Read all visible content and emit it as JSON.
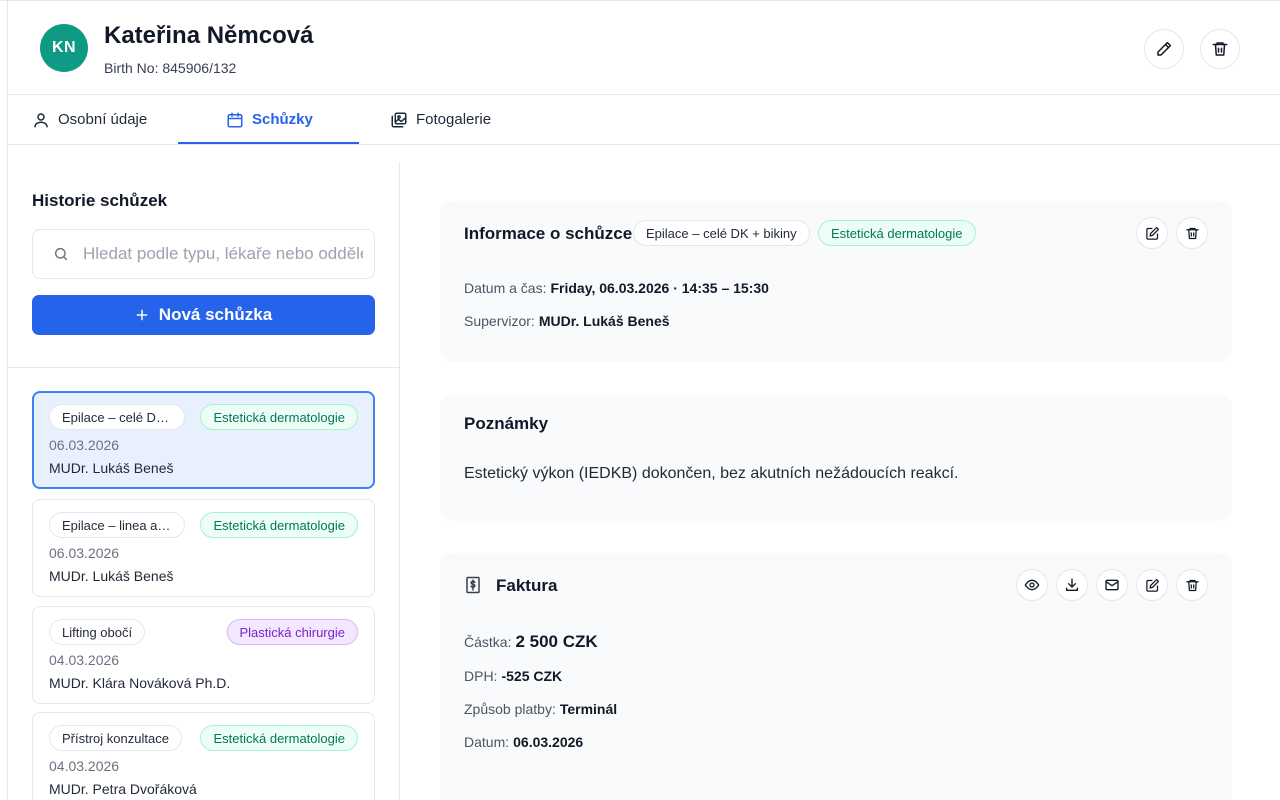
{
  "patient": {
    "initials": "KN",
    "name": "Kateřina Němcová",
    "birth_no": "Birth No: 845906/132"
  },
  "tabs": [
    {
      "label": "Osobní údaje",
      "icon": "user-icon",
      "active": false
    },
    {
      "label": "Schůzky",
      "icon": "calendar-icon",
      "active": true
    },
    {
      "label": "Fotogalerie",
      "icon": "gallery-icon",
      "active": false
    }
  ],
  "history": {
    "title": "Historie schůzek",
    "search_placeholder": "Hledat podle typu, lékaře nebo oddělení",
    "new_button": "Nová schůzka",
    "items": [
      {
        "type": "Epilace – celé DK + bikiny",
        "dept": "Estetická dermatologie",
        "dept_color": "green",
        "date": "06.03.2026",
        "doctor": "MUDr. Lukáš Beneš",
        "selected": true
      },
      {
        "type": "Epilace – linea alba",
        "dept": "Estetická dermatologie",
        "dept_color": "green",
        "date": "06.03.2026",
        "doctor": "MUDr. Lukáš Beneš",
        "selected": false
      },
      {
        "type": "Lifting obočí",
        "dept": "Plastická chirurgie",
        "dept_color": "purple",
        "date": "04.03.2026",
        "doctor": "MUDr. Klára Nováková Ph.D.",
        "selected": false
      },
      {
        "type": "Přístroj konzultace",
        "dept": "Estetická dermatologie",
        "dept_color": "green",
        "date": "04.03.2026",
        "doctor": "MUDr. Petra Dvořáková",
        "selected": false
      }
    ]
  },
  "info": {
    "title": "Informace o schůzce",
    "type_chip": "Epilace – celé DK + bikiny",
    "dept_chip": "Estetická dermatologie",
    "datetime_label": "Datum a čas:",
    "datetime_value": "Friday, 06.03.2026 · 14:35 – 15:30",
    "supervisor_label": "Supervizor:",
    "supervisor_value": "MUDr. Lukáš Beneš"
  },
  "notes": {
    "title": "Poznámky",
    "text": "Estetický výkon (IEDKB) dokončen, bez akutních nežádoucích reakcí."
  },
  "invoice": {
    "title": "Faktura",
    "amount_label": "Částka:",
    "amount_value": "2 500 CZK",
    "vat_label": "DPH:",
    "vat_value": "-525 CZK",
    "payment_label": "Způsob platby:",
    "payment_value": "Terminál",
    "date_label": "Datum:",
    "date_value": "06.03.2026"
  },
  "colors": {
    "accent": "#2563eb",
    "avatar": "#0f9a86",
    "dept_green": "#047857",
    "dept_purple": "#7e22ce"
  }
}
